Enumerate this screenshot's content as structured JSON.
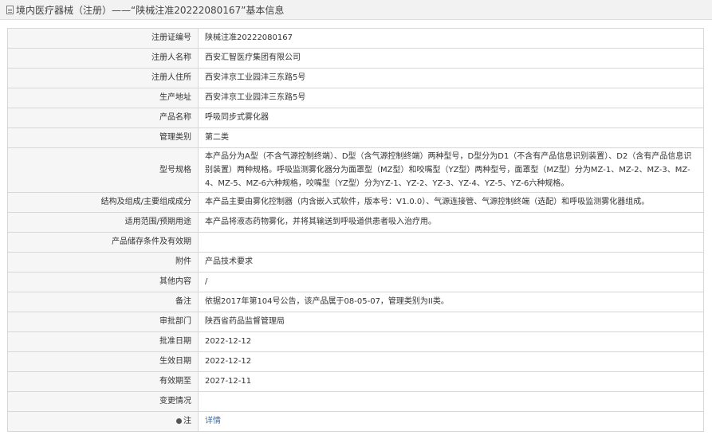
{
  "header": {
    "title": "境内医疗器械（注册）——“陕械注准20222080167”基本信息",
    "icon": "document-icon"
  },
  "rows": [
    {
      "label": "注册证编号",
      "value": "陕械注准20222080167"
    },
    {
      "label": "注册人名称",
      "value": "西安汇智医疗集团有限公司"
    },
    {
      "label": "注册人住所",
      "value": "西安沣京工业园沣三东路5号"
    },
    {
      "label": "生产地址",
      "value": "西安沣京工业园沣三东路5号"
    },
    {
      "label": "产品名称",
      "value": "呼吸同步式雾化器"
    },
    {
      "label": "管理类别",
      "value": "第二类"
    },
    {
      "label": "型号规格",
      "value": "本产品分为A型（不含气源控制终端）、D型（含气源控制终端）两种型号，D型分为D1（不含有产品信息识别装置）、D2（含有产品信息识别装置）两种规格。呼吸监测雾化器分为面罩型（MZ型）和咬嘴型（YZ型）两种型号，面罩型（MZ型）分为MZ-1、MZ-2、MZ-3、MZ-4、MZ-5、MZ-6六种规格，咬嘴型（YZ型）分为YZ-1、YZ-2、YZ-3、YZ-4、YZ-5、YZ-6六种规格。"
    },
    {
      "label": "结构及组成/主要组成成分",
      "value": "本产品主要由雾化控制器（内含嵌入式软件，版本号：V1.0.0）、气源连接管、气源控制终端（选配）和呼吸监测雾化器组成。"
    },
    {
      "label": "适用范围/预期用途",
      "value": "本产品将液态药物雾化，并将其输送到呼吸道供患者吸入治疗用。"
    },
    {
      "label": "产品储存条件及有效期",
      "value": ""
    },
    {
      "label": "附件",
      "value": "产品技术要求"
    },
    {
      "label": "其他内容",
      "value": "/"
    },
    {
      "label": "备注",
      "value": "依据2017年第104号公告，该产品属于08-05-07，管理类别为II类。"
    },
    {
      "label": "审批部门",
      "value": "陕西省药品监督管理局"
    },
    {
      "label": "批准日期",
      "value": "2022-12-12"
    },
    {
      "label": "生效日期",
      "value": "2022-12-12"
    },
    {
      "label": "有效期至",
      "value": "2027-12-11"
    },
    {
      "label": "变更情况",
      "value": ""
    }
  ],
  "note_row": {
    "label": "注",
    "link": "详情",
    "icon": "pin-icon"
  },
  "colors": {
    "link": "#3a6ea5",
    "label_bg": "#f6f6f6",
    "border": "#d7d7d7"
  }
}
